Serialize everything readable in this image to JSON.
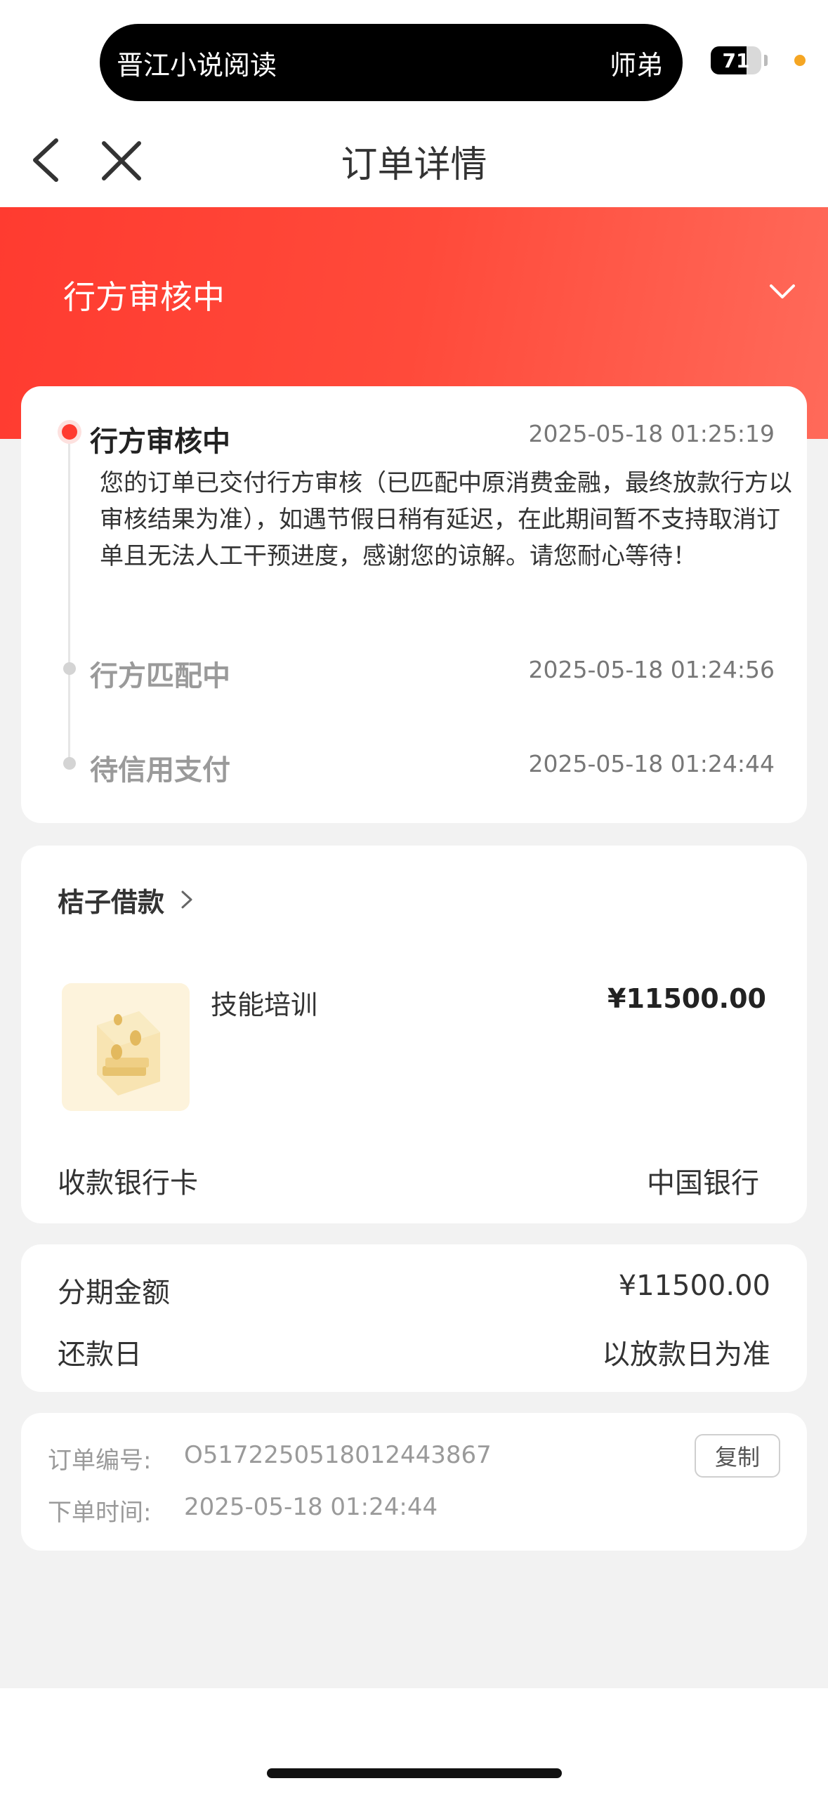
{
  "status_bar": {
    "app_name": "晋江小说阅读",
    "user": "师弟",
    "battery": "71",
    "battery_level": 0.71
  },
  "nav": {
    "title": "订单详情"
  },
  "banner": {
    "status": "行方审核中"
  },
  "timeline": {
    "current": {
      "title": "行方审核中",
      "time": "2025-05-18 01:25:19",
      "description": "您的订单已交付行方审核（已匹配中原消费金融，最终放款行方以审核结果为准），如遇节假日稍有延迟，在此期间暂不支持取消订单且无法人工干预进度，感谢您的谅解。请您耐心等待！"
    },
    "steps": [
      {
        "title": "行方匹配中",
        "time": "2025-05-18 01:24:56"
      },
      {
        "title": "待信用支付",
        "time": "2025-05-18 01:24:44"
      }
    ]
  },
  "product": {
    "merchant": "桔子借款",
    "name": "技能培训",
    "price": "¥11500.00",
    "bank_label": "收款银行卡",
    "bank_value": "中国银行"
  },
  "installment": {
    "amount_label": "分期金额",
    "amount_value": "¥11500.00",
    "due_label": "还款日",
    "due_value": "以放款日为准"
  },
  "order": {
    "number_label": "订单编号:",
    "number_value": "O5172250518012443867",
    "time_label": "下单时间:",
    "time_value": "2025-05-18 01:24:44",
    "copy_label": "复制"
  },
  "colors": {
    "accent": "#ff3b30",
    "background": "#f2f2f2"
  }
}
